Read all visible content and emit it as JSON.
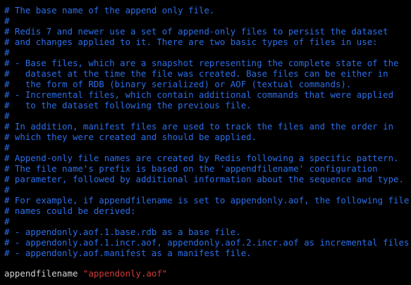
{
  "editor": {
    "comment_lines": [
      "# The base name of the append only file.",
      "#",
      "# Redis 7 and newer use a set of append-only files to persist the dataset",
      "# and changes applied to it. There are two basic types of files in use:",
      "#",
      "# - Base files, which are a snapshot representing the complete state of the",
      "#   dataset at the time the file was created. Base files can be either in",
      "#   the form of RDB (binary serialized) or AOF (textual commands).",
      "# - Incremental files, which contain additional commands that were applied",
      "#   to the dataset following the previous file.",
      "#",
      "# In addition, manifest files are used to track the files and the order in",
      "# which they were created and should be applied.",
      "#",
      "# Append-only file names are created by Redis following a specific pattern.",
      "# The file name's prefix is based on the 'appendfilename' configuration",
      "# parameter, followed by additional information about the sequence and type.",
      "#",
      "# For example, if appendfilename is set to appendonly.aof, the following file",
      "# names could be derived:",
      "#",
      "# - appendonly.aof.1.base.rdb as a base file.",
      "# - appendonly.aof.1.incr.aof, appendonly.aof.2.incr.aof as incremental files.",
      "# - appendonly.aof.manifest as a manifest file."
    ],
    "config_key": "appendfilename",
    "config_value": "\"appendonly.aof\"",
    "colors": {
      "background": "#000000",
      "comment": "#2b6ee8",
      "key": "#d2d2d2",
      "string": "#d23a3a"
    }
  }
}
